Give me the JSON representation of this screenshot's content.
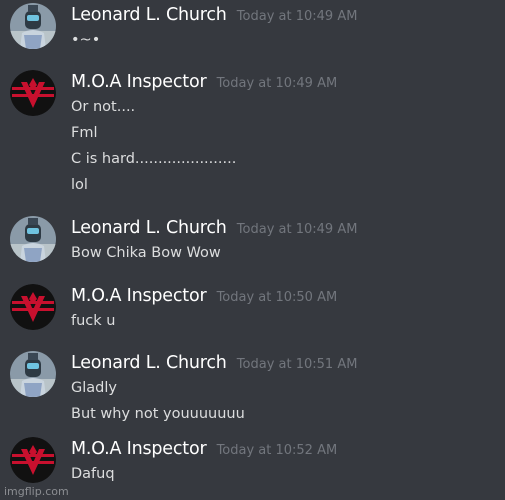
{
  "messages": [
    {
      "username": "Leonard L. Church",
      "timestamp": "Today at 10:49 AM",
      "avatar_icon": "church-avatar-icon",
      "lines": [
        "•~•"
      ]
    },
    {
      "username": "M.O.A Inspector",
      "timestamp": "Today at 10:49 AM",
      "avatar_icon": "arstotzka-emblem-avatar-icon",
      "lines": [
        "Or not....",
        "Fml",
        "C is hard......................",
        "lol"
      ]
    },
    {
      "username": "Leonard L. Church",
      "timestamp": "Today at 10:49 AM",
      "avatar_icon": "church-avatar-icon",
      "lines": [
        "Bow Chika Bow Wow"
      ]
    },
    {
      "username": "M.O.A Inspector",
      "timestamp": "Today at 10:50 AM",
      "avatar_icon": "arstotzka-emblem-avatar-icon",
      "lines": [
        "fuck u"
      ]
    },
    {
      "username": "Leonard L. Church",
      "timestamp": "Today at 10:51 AM",
      "avatar_icon": "church-avatar-icon",
      "lines": [
        "Gladly",
        "But why not youuuuuuu"
      ]
    },
    {
      "username": "M.O.A Inspector",
      "timestamp": "Today at 10:52 AM",
      "avatar_icon": "arstotzka-emblem-avatar-icon",
      "lines": [
        "Dafuq"
      ]
    }
  ],
  "watermark": "imgflip.com",
  "colors": {
    "background": "#36393f",
    "username": "#ffffff",
    "timestamp": "#72767d",
    "message_text": "#dcddde",
    "emblem_red": "#c8102e"
  }
}
